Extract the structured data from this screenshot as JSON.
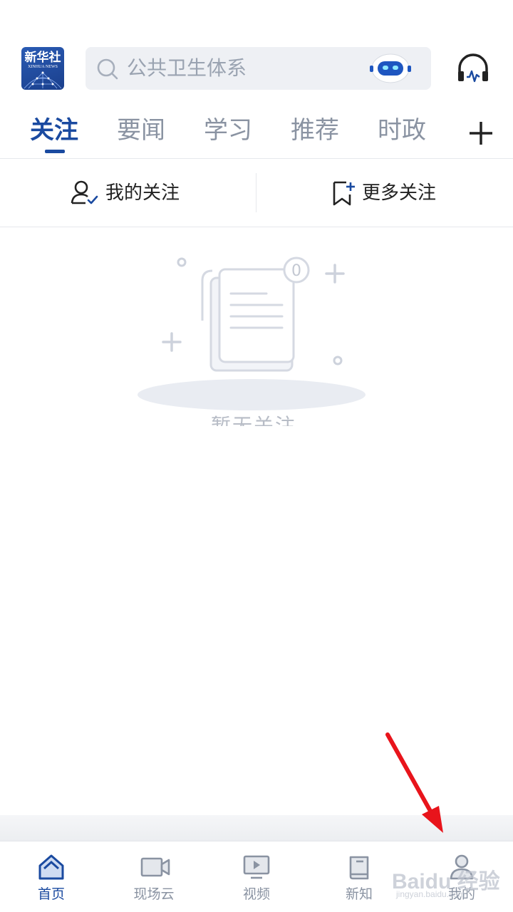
{
  "header": {
    "logo": {
      "name_cn": "新华社",
      "name_en": "XINHUA NEWS"
    },
    "search": {
      "placeholder": "公共卫生体系",
      "icon": "search-icon",
      "assistant_icon": "robot-icon"
    },
    "audio_icon": "headphone-icon"
  },
  "tabs": [
    {
      "label": "关注",
      "active": true
    },
    {
      "label": "要闻",
      "active": false
    },
    {
      "label": "学习",
      "active": false
    },
    {
      "label": "推荐",
      "active": false
    },
    {
      "label": "时政",
      "active": false
    }
  ],
  "add_channel_icon": "plus-icon",
  "follow_bar": {
    "my_follow": {
      "label": "我的关注",
      "icon": "user-check-icon"
    },
    "more_follow": {
      "label": "更多关注",
      "icon": "bookmark-add-icon"
    }
  },
  "empty_state": {
    "badge_count": "0",
    "text": "暂无关注"
  },
  "bottom_nav": [
    {
      "label": "首页",
      "icon": "home-icon",
      "active": true
    },
    {
      "label": "现场云",
      "icon": "video-camera-icon",
      "active": false
    },
    {
      "label": "视频",
      "icon": "play-screen-icon",
      "active": false
    },
    {
      "label": "新知",
      "icon": "book-icon",
      "active": false
    },
    {
      "label": "我的",
      "icon": "person-icon",
      "active": false
    }
  ],
  "watermark": {
    "brand": "Baidu 经验",
    "url": "jingyan.baidu.com"
  },
  "colors": {
    "accent": "#1a4aa0",
    "inactive": "#8a93a2",
    "annotation_arrow": "#e8141b"
  }
}
